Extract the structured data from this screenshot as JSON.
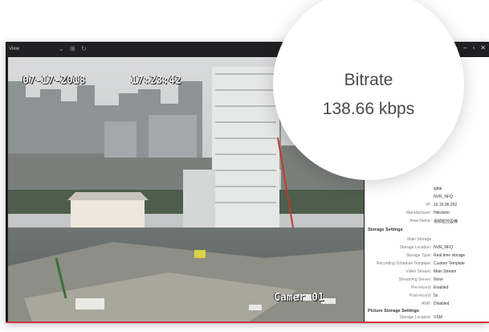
{
  "app": {
    "title": "View"
  },
  "window_controls": [
    "⌂",
    "–",
    "▫",
    "✕"
  ],
  "video": {
    "osd_date": "07-17-2018",
    "osd_time": "17:23:42",
    "osd_camera": "Camer  01"
  },
  "bitrate": {
    "label": "Bitrate",
    "value": "138.66 kbps"
  },
  "panel": {
    "partial_rows": [
      {
        "key": "",
        "value": "igital"
      },
      {
        "key": "",
        "value": "NVR_NFQ"
      },
      {
        "key": "IP:",
        "value": "10.16.96.202"
      },
      {
        "key": "Manufacturer:",
        "value": "Hikvision"
      },
      {
        "key": "Area Name:",
        "value": "視頻監控設備"
      }
    ],
    "storage_settings": {
      "heading": "Storage Settings",
      "rows": [
        {
          "key": "Main Storage",
          "value": ""
        },
        {
          "key": "Storage Location:",
          "value": "NVR_NFQ"
        },
        {
          "key": "Storage Type:",
          "value": "Real time storage"
        },
        {
          "key": "Recording Schedule Template:",
          "value": "Custom Template"
        },
        {
          "key": "Video Stream:",
          "value": "Main Stream"
        },
        {
          "key": "Streaming Server:",
          "value": "None"
        },
        {
          "key": "Pre-record:",
          "value": "Enabled"
        },
        {
          "key": "Post-record:",
          "value": "5s"
        },
        {
          "key": "ANR:",
          "value": "Disabled"
        }
      ]
    },
    "picture_storage": {
      "heading": "Picture Storage Settings",
      "rows": [
        {
          "key": "Storage Location:",
          "value": "VSM"
        }
      ]
    }
  }
}
